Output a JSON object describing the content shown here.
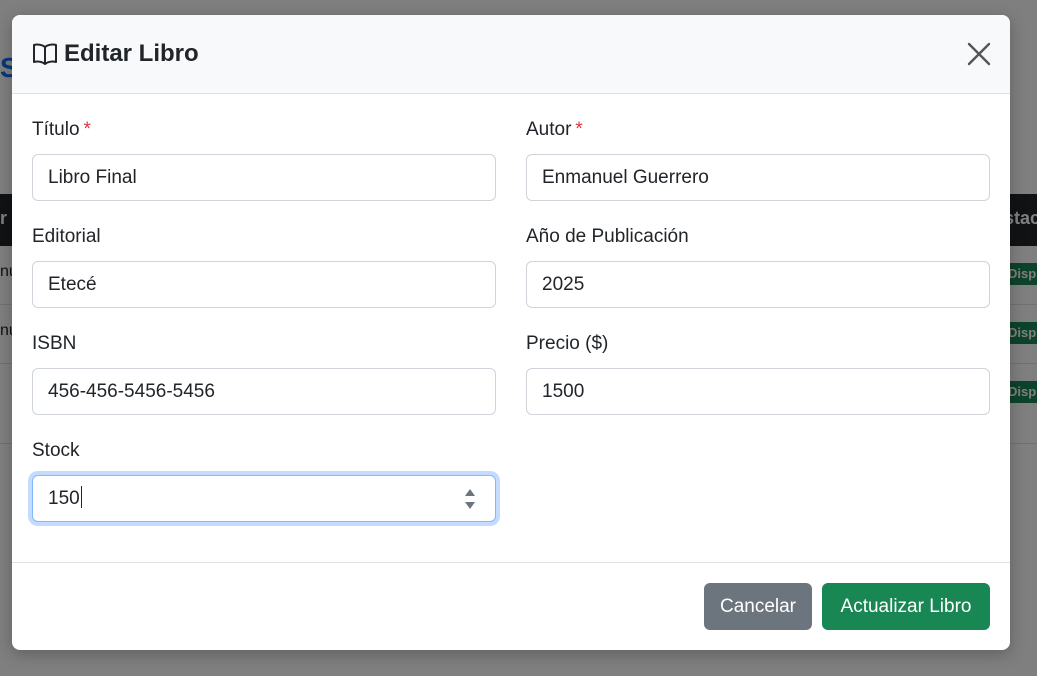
{
  "background": {
    "title_fragment": "S",
    "table_header_fragments": [
      "r",
      "stac"
    ],
    "row_fragments": [
      "nu",
      "nu",
      ""
    ],
    "badge_label": "Disp"
  },
  "modal": {
    "title": "Editar Libro",
    "icon": "book-icon",
    "close_icon": "close-icon",
    "required_marker": "*",
    "fields": {
      "titulo": {
        "label": "Título",
        "value": "Libro Final",
        "required": true
      },
      "autor": {
        "label": "Autor",
        "value": "Enmanuel Guerrero",
        "required": true
      },
      "editorial": {
        "label": "Editorial",
        "value": "Etecé"
      },
      "anio": {
        "label": "Año de Publicación",
        "value": "2025"
      },
      "isbn": {
        "label": "ISBN",
        "value": "456-456-5456-5456"
      },
      "precio": {
        "label": "Precio ($)",
        "value": "1500"
      },
      "stock": {
        "label": "Stock",
        "value": "150"
      }
    },
    "buttons": {
      "cancel": "Cancelar",
      "submit": "Actualizar Libro"
    }
  },
  "colors": {
    "primary": "#0d6efd",
    "success": "#198754",
    "secondary": "#6c757d",
    "danger": "#dc3545"
  }
}
